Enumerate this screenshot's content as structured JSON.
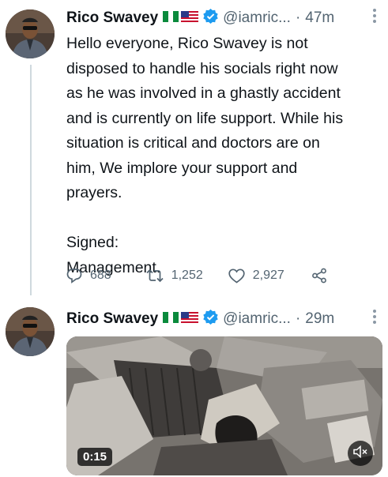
{
  "tweets": [
    {
      "author_name": "Rico Swavey",
      "handle": "@iamric...",
      "separator": "·",
      "time": "47m",
      "text": "Hello everyone, Rico Swavey is not\ndisposed to handle his socials right now\nas he was involved in a ghastly accident\nand is currently on life support. While his\nsituation is critical and doctors are on\nhim, We implore your support and\nprayers.\n\nSigned:\nManagement.",
      "replies": "688",
      "retweets": "1,252",
      "likes": "2,927"
    },
    {
      "author_name": "Rico Swavey",
      "handle": "@iamric...",
      "separator": "·",
      "time": "29m",
      "video_duration": "0:15"
    }
  ],
  "flags": [
    "nigeria-flag-icon",
    "us-flag-icon"
  ],
  "colors": {
    "verified": "#1d9bf0",
    "secondary_text": "#536471",
    "thread_line": "#cfd9de"
  }
}
